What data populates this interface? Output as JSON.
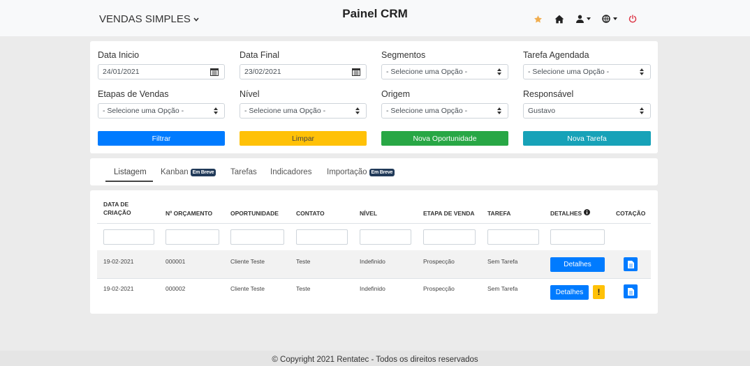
{
  "header": {
    "brand": "VENDAS SIMPLES",
    "title": "Painel CRM",
    "icons": [
      "star-icon",
      "home-icon",
      "user-icon",
      "globe-icon",
      "power-icon"
    ]
  },
  "filters": {
    "data_inicio": {
      "label": "Data Inicio",
      "value": "24/01/2021"
    },
    "data_final": {
      "label": "Data Final",
      "value": "23/02/2021"
    },
    "segmentos": {
      "label": "Segmentos",
      "value": "- Selecione uma Opção -"
    },
    "tarefa_agendada": {
      "label": "Tarefa Agendada",
      "value": "- Selecione uma Opção -"
    },
    "etapas_vendas": {
      "label": "Etapas de Vendas",
      "value": "- Selecione uma Opção -"
    },
    "nivel": {
      "label": "Nível",
      "value": "- Selecione uma Opção -"
    },
    "origem": {
      "label": "Origem",
      "value": "- Selecione uma Opção -"
    },
    "responsavel": {
      "label": "Responsável",
      "value": "Gustavo"
    },
    "buttons": {
      "filtrar": "Filtrar",
      "limpar": "Limpar",
      "nova_oportunidade": "Nova Oportunidade",
      "nova_tarefa": "Nova Tarefa"
    }
  },
  "tabs": [
    {
      "label": "Listagem",
      "badge": "",
      "active": true
    },
    {
      "label": "Kanban",
      "badge": "Em Breve"
    },
    {
      "label": "Tarefas",
      "badge": ""
    },
    {
      "label": "Indicadores",
      "badge": ""
    },
    {
      "label": "Importação",
      "badge": "Em Breve"
    }
  ],
  "table": {
    "headers": {
      "data_criacao_1": "DATA DE",
      "data_criacao_2": "CRIAÇÃO",
      "orcamento": "Nº ORÇAMENTO",
      "oportunidade": "OPORTUNIDADE",
      "contato": "CONTATO",
      "nivel": "NÍVEL",
      "etapa": "ETAPA DE VENDA",
      "tarefa": "TAREFA",
      "detalhes": "DETALHES",
      "cotacao": "COTAÇÃO"
    },
    "rows": [
      {
        "data": "19-02-2021",
        "orcamento": "000001",
        "oportunidade": "Cliente Teste",
        "contato": "Teste",
        "nivel": "Indefinido",
        "etapa": "Prospecção",
        "tarefa": "Sem Tarefa",
        "detalhes": "Detalhes",
        "warning": ""
      },
      {
        "data": "19-02-2021",
        "orcamento": "000002",
        "oportunidade": "Cliente Teste",
        "contato": "Teste",
        "nivel": "Indefinido",
        "etapa": "Prospecção",
        "tarefa": "Sem Tarefa",
        "detalhes": "Detalhes",
        "warning": "!"
      }
    ]
  },
  "footer": "© Copyright 2021 Rentatec - Todos os direitos reservados",
  "colors": {
    "primary": "#007bff",
    "warning": "#ffc107",
    "success": "#28a745",
    "info": "#17a2b8",
    "badge": "#213a59"
  }
}
